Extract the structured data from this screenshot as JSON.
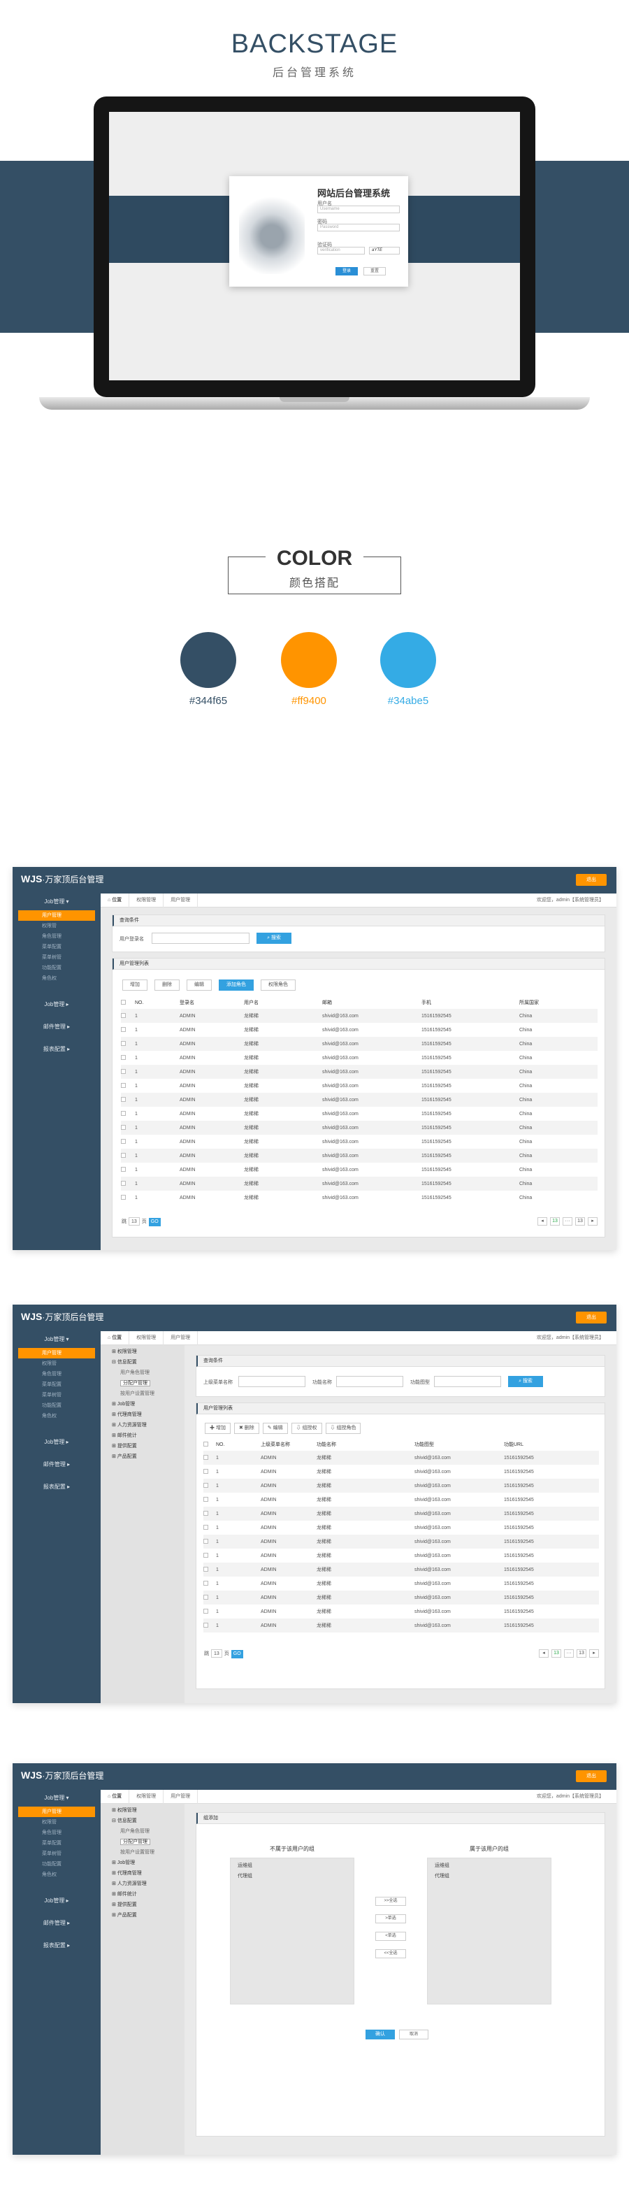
{
  "hero": {
    "title": "BACKSTAGE",
    "subtitle": "后台管理系统"
  },
  "login": {
    "title": "网站后台管理系统",
    "user_label": "用户名",
    "user_placeholder": "Username",
    "pwd_label": "密码",
    "pwd_placeholder": "Password",
    "code_label": "验证码",
    "code_placeholder": "verification",
    "code_value": "aYTE",
    "login_btn": "登录",
    "reset_btn": "重置"
  },
  "color": {
    "title": "COLOR",
    "subtitle": "颜色搭配",
    "swatches": [
      {
        "hex": "#344f65",
        "label": "#344f65"
      },
      {
        "hex": "#ff9400",
        "label": "#ff9400"
      },
      {
        "hex": "#34abe5",
        "label": "#34abe5"
      }
    ]
  },
  "app": {
    "logo": "WJS",
    "logo_sub": "·万家顶后台管理",
    "exit_btn": "退出",
    "sidebar": {
      "groups": [
        "Job管理 ▾",
        "Job管理 ▸",
        "邮件管理 ▸",
        "报表配置 ▸"
      ],
      "subs": [
        "用户管理",
        "权限管",
        "角色管理",
        "菜单配置",
        "菜单树管",
        "功能配置",
        "角色权"
      ]
    },
    "crumbs": [
      "位置",
      "权限管理",
      "用户管理"
    ],
    "welcome": "欢迎您，admin【系统管理员】"
  },
  "screen1": {
    "search_title": "查询条件",
    "field_label": "用户登录名",
    "search_btn": "搜索",
    "list_title": "用户管理列表",
    "buttons": [
      "增加",
      "删除",
      "编辑",
      "添加角色",
      "权限角色"
    ],
    "columns": [
      "NO.",
      "登录名",
      "用户名",
      "邮箱",
      "手机",
      "所属国家"
    ],
    "rows": [
      [
        "1",
        "ADMIN",
        "龙稀稀",
        "shivid@163.com",
        "15161592545",
        "China"
      ],
      [
        "1",
        "ADMIN",
        "龙稀稀",
        "shivid@163.com",
        "15161592545",
        "China"
      ],
      [
        "1",
        "ADMIN",
        "龙稀稀",
        "shivid@163.com",
        "15161592545",
        "China"
      ],
      [
        "1",
        "ADMIN",
        "龙稀稀",
        "shivid@163.com",
        "15161592545",
        "China"
      ],
      [
        "1",
        "ADMIN",
        "龙稀稀",
        "shivid@163.com",
        "15161592545",
        "China"
      ],
      [
        "1",
        "ADMIN",
        "龙稀稀",
        "shivid@163.com",
        "15161592545",
        "China"
      ],
      [
        "1",
        "ADMIN",
        "龙稀稀",
        "shivid@163.com",
        "15161592545",
        "China"
      ],
      [
        "1",
        "ADMIN",
        "龙稀稀",
        "shivid@163.com",
        "15161592545",
        "China"
      ],
      [
        "1",
        "ADMIN",
        "龙稀稀",
        "shivid@163.com",
        "15161592545",
        "China"
      ],
      [
        "1",
        "ADMIN",
        "龙稀稀",
        "shivid@163.com",
        "15161592545",
        "China"
      ],
      [
        "1",
        "ADMIN",
        "龙稀稀",
        "shivid@163.com",
        "15161592545",
        "China"
      ],
      [
        "1",
        "ADMIN",
        "龙稀稀",
        "shivid@163.com",
        "15161592545",
        "China"
      ],
      [
        "1",
        "ADMIN",
        "龙稀稀",
        "shivid@163.com",
        "15161592545",
        "China"
      ],
      [
        "1",
        "ADMIN",
        "龙稀稀",
        "shivid@163.com",
        "15161592545",
        "China"
      ]
    ],
    "pager_left": [
      "跳",
      "13",
      "页",
      "GO"
    ],
    "pager_right": [
      "◂",
      "13",
      "···",
      "13",
      "▸"
    ]
  },
  "tree": {
    "items": [
      "权限管理",
      "信息配置",
      "用户角色管理",
      "分配户管理",
      "按用户设置管理",
      "Job管理",
      "代理商管理",
      "人力资源管理",
      "邮件统计",
      "提供配置",
      "产品配置"
    ]
  },
  "screen2": {
    "search_title": "查询条件",
    "fields": [
      "上级菜单名称",
      "功能名称",
      "功能图型"
    ],
    "search_btn": "搜索",
    "list_title": "用户管理列表",
    "buttons": [
      "✚ 增加",
      "✖ 删除",
      "✎ 编辑",
      "⇩ 组授权",
      "⇩ 组授角色"
    ],
    "columns": [
      "NO.",
      "上级菜单名称",
      "功能名称",
      "功能图型",
      "功能URL"
    ],
    "rows": [
      [
        "1",
        "ADMIN",
        "龙稀稀",
        "shivid@163.com",
        "15161592545"
      ],
      [
        "1",
        "ADMIN",
        "龙稀稀",
        "shivid@163.com",
        "15161592545"
      ],
      [
        "1",
        "ADMIN",
        "龙稀稀",
        "shivid@163.com",
        "15161592545"
      ],
      [
        "1",
        "ADMIN",
        "龙稀稀",
        "shivid@163.com",
        "15161592545"
      ],
      [
        "1",
        "ADMIN",
        "龙稀稀",
        "shivid@163.com",
        "15161592545"
      ],
      [
        "1",
        "ADMIN",
        "龙稀稀",
        "shivid@163.com",
        "15161592545"
      ],
      [
        "1",
        "ADMIN",
        "龙稀稀",
        "shivid@163.com",
        "15161592545"
      ],
      [
        "1",
        "ADMIN",
        "龙稀稀",
        "shivid@163.com",
        "15161592545"
      ],
      [
        "1",
        "ADMIN",
        "龙稀稀",
        "shivid@163.com",
        "15161592545"
      ],
      [
        "1",
        "ADMIN",
        "龙稀稀",
        "shivid@163.com",
        "15161592545"
      ],
      [
        "1",
        "ADMIN",
        "龙稀稀",
        "shivid@163.com",
        "15161592545"
      ],
      [
        "1",
        "ADMIN",
        "龙稀稀",
        "shivid@163.com",
        "15161592545"
      ],
      [
        "1",
        "ADMIN",
        "龙稀稀",
        "shivid@163.com",
        "15161592545"
      ]
    ],
    "pager_left": [
      "跳",
      "13",
      "页",
      "GO"
    ],
    "pager_right": [
      "◂",
      "13",
      "···",
      "13",
      "▸"
    ]
  },
  "screen3": {
    "title": "组添加",
    "left_title": "不属于该用户的组",
    "right_title": "属于该用户的组",
    "left_items": [
      "运维组",
      "代理组"
    ],
    "right_items": [
      "运维组",
      "代理组"
    ],
    "move_buttons": [
      ">>全选",
      ">单选",
      "<单选",
      "<<全选"
    ],
    "ok_btn": "确认",
    "cancel_btn": "取消"
  }
}
